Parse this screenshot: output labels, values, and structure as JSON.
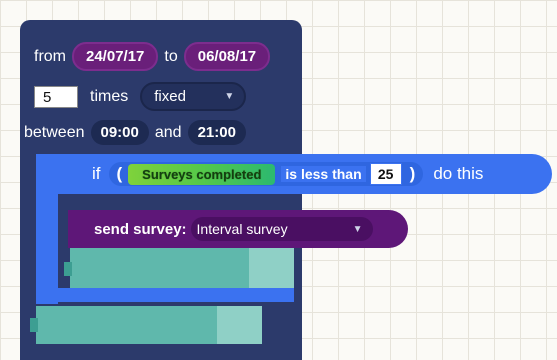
{
  "schedule": {
    "from_label": "from",
    "from_date": "24/07/17",
    "to_label": "to",
    "to_date": "06/08/17",
    "times_value": "5",
    "times_label": "times",
    "frequency_mode": "fixed",
    "between_label": "between",
    "start_time": "09:00",
    "and_label": "and",
    "end_time": "21:00"
  },
  "condition": {
    "if_label": "if",
    "open_paren": "(",
    "variable": "Surveys completed",
    "operator": "is less than",
    "value": "25",
    "close_paren": ")",
    "do_label": "do this"
  },
  "action": {
    "label": "send survey:",
    "survey": "Interval survey"
  },
  "icons": {
    "dropdown": "chevron-down-icon"
  },
  "colors": {
    "schedule_block": "#2c3a6b",
    "date_pill": "#6a1f7a",
    "if_block": "#3b72f0",
    "survey_variable": "#55c84a",
    "send_block": "#5e1778",
    "slot": "#5fb8ac"
  }
}
